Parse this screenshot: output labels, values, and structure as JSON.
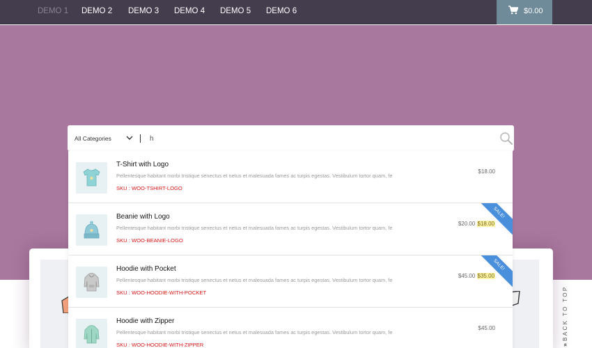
{
  "nav": {
    "items": [
      "DEMO 1",
      "DEMO 2",
      "DEMO 3",
      "DEMO 4",
      "DEMO 5",
      "DEMO 6"
    ],
    "active_index": 0,
    "cart_total": "$0.00"
  },
  "search": {
    "category": "All Categories",
    "query": "h"
  },
  "results": [
    {
      "title": "T-Shirt with Logo",
      "description": "Pellentesque habitant morbi tristique senectus et netus et malesuada fames ac turpis egestas. Vestibulum tortor quam, fe",
      "sku": "SKU : WOO-TSHIRT-LOGO",
      "price": "$18.00",
      "icon": "tshirt-icon"
    },
    {
      "title": "Beanie with Logo",
      "description": "Pellentesque habitant morbi tristique senectus et netus et malesuada fames ac turpis egestas. Vestibulum tortor quam, fe",
      "sku": "SKU : WOO-BEANIE-LOGO",
      "regular_price": "$20.00",
      "sale_price": "$18.00",
      "badge": "SALE!",
      "icon": "beanie-icon"
    },
    {
      "title": "Hoodie with Pocket",
      "description": "Pellentesque habitant morbi tristique senectus et netus et malesuada fames ac turpis egestas. Vestibulum tortor quam, fe",
      "sku": "SKU : WOO-HOODIE-WITH-POCKET",
      "regular_price": "$45.00",
      "sale_price": "$35.00",
      "badge": "SALE!",
      "icon": "hoodie-icon"
    },
    {
      "title": "Hoodie with Zipper",
      "description": "Pellentesque habitant morbi tristique senectus et netus et malesuada fames ac turpis egestas. Vestibulum tortor quam, fe",
      "sku": "SKU : WOO-HOODIE-WITH-ZIPPER",
      "price": "$45.00",
      "icon": "hoodie-zipper-icon"
    }
  ],
  "back_to_top": "BACK TO TOP",
  "colors": {
    "nav_bg": "#443d4e",
    "hero_bg": "#a9789f",
    "cart_bg": "#6f8a98",
    "sale_ribbon": "#4a8fdb",
    "sku_red": "#d41414"
  }
}
